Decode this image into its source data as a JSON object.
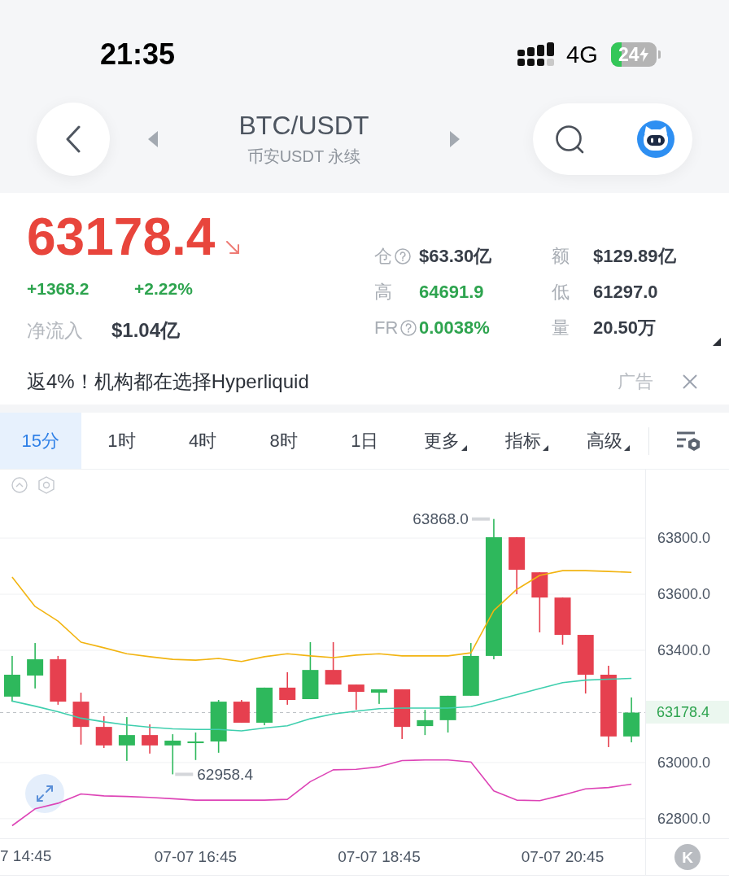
{
  "status_bar": {
    "time": "21:35",
    "network": "4G",
    "battery": {
      "percent": "24",
      "level": 0.24,
      "charging": true
    }
  },
  "header": {
    "title": "BTC/USDT",
    "subtitle": "币安USDT 永续"
  },
  "ticker": {
    "price": {
      "text": "63178.4",
      "color": "#e8453c",
      "falling": true
    },
    "change": {
      "text": "+1368.2",
      "color": "#2ea44f"
    },
    "change_percent": {
      "text": "+2.22%",
      "color": "#2ea44f"
    },
    "net_inflow": {
      "label": "净流入",
      "value": "$1.04亿"
    }
  },
  "stats": [
    {
      "label": "仓",
      "help": true,
      "value": "$63.30亿",
      "color": "#383e48"
    },
    {
      "label": "额",
      "help": false,
      "value": "$129.89亿",
      "color": "#383e48"
    },
    {
      "label": "高",
      "help": false,
      "value": "64691.9",
      "color": "#2ea44f"
    },
    {
      "label": "低",
      "help": false,
      "value": "61297.0",
      "color": "#383e48"
    },
    {
      "label": "FR",
      "help": true,
      "value": "0.0038%",
      "color": "#2ea44f"
    },
    {
      "label": "量",
      "help": false,
      "value": "20.50万",
      "color": "#383e48"
    }
  ],
  "ad": {
    "text": "返4%！机构都在选择Hyperliquid",
    "tag": "广告"
  },
  "intervals": [
    {
      "label": "15分",
      "selected": true,
      "dropdown": false
    },
    {
      "label": "1时",
      "selected": false,
      "dropdown": false
    },
    {
      "label": "4时",
      "selected": false,
      "dropdown": false
    },
    {
      "label": "8时",
      "selected": false,
      "dropdown": false
    },
    {
      "label": "1日",
      "selected": false,
      "dropdown": false
    },
    {
      "label": "更多",
      "selected": false,
      "dropdown": true
    },
    {
      "label": "指标",
      "selected": false,
      "dropdown": true
    },
    {
      "label": "高级",
      "selected": false,
      "dropdown": true
    }
  ],
  "chart": {
    "floating_button": "K",
    "edge_time_label": "7 14:45",
    "chart_data": {
      "type": "line",
      "grid": true,
      "categories": [
        null,
        null,
        null,
        null,
        null,
        null,
        null,
        null,
        "07-07 16:45",
        null,
        null,
        null,
        null,
        null,
        null,
        null,
        "07-07 18:45",
        null,
        null,
        null,
        null,
        null,
        null,
        null,
        "07-07 20:45",
        null,
        null,
        null
      ],
      "ylim": [
        62730,
        64044
      ],
      "yticks": [
        {
          "value": 63800,
          "label": "63800.0"
        },
        {
          "value": 63600,
          "label": "63600.0"
        },
        {
          "value": 63400,
          "label": "63400.0"
        },
        {
          "value": 63000,
          "label": "63000.0"
        },
        {
          "value": 62800,
          "label": "62800.0"
        }
      ],
      "series": [
        {
          "color": "#f2b411",
          "values": [
            63661,
            63556,
            63504,
            63429,
            63409,
            63388,
            63377,
            63368,
            63365,
            63371,
            63360,
            63377,
            63388,
            63380,
            63374,
            63383,
            63388,
            63380,
            63380,
            63380,
            63391,
            63542,
            63617,
            63667,
            63684,
            63684,
            63681,
            63678
          ]
        },
        {
          "color": "#3fcfae",
          "values": [
            63219,
            63201,
            63181,
            63158,
            63145,
            63134,
            63126,
            63120,
            63118,
            63118,
            63113,
            63123,
            63131,
            63156,
            63173,
            63183,
            63192,
            63194,
            63194,
            63194,
            63199,
            63220,
            63242,
            63264,
            63285,
            63294,
            63297,
            63300
          ]
        },
        {
          "color": "#dd44b6",
          "values": [
            62775,
            62835,
            62855,
            62888,
            62881,
            62879,
            62876,
            62871,
            62866,
            62866,
            62866,
            62866,
            62869,
            62932,
            62974,
            62976,
            62985,
            63007,
            63009,
            63009,
            63002,
            62899,
            62866,
            62864,
            62884,
            62906,
            62911,
            62923
          ]
        }
      ],
      "ref_lines": [
        {
          "axis": "y",
          "value": 63178.4,
          "label": "63178.4"
        }
      ],
      "annotations": [
        "63868.0",
        "62958.4"
      ]
    }
  }
}
